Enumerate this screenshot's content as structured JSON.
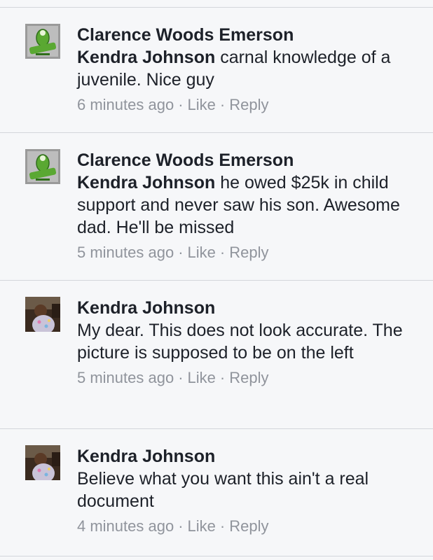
{
  "comments": [
    {
      "author": "Clarence Woods Emerson",
      "mention": "Kendra Johnson",
      "text": " carnal knowledge of a juvenile. Nice guy",
      "time": "6 minutes ago",
      "like": "Like",
      "reply": "Reply",
      "avatar": "turtle-logo-avatar"
    },
    {
      "author": "Clarence Woods Emerson",
      "mention": "Kendra Johnson",
      "text": " he owed $25k in child support and never saw his son. Awesome dad. He'll be missed",
      "time": "5 minutes ago",
      "like": "Like",
      "reply": "Reply",
      "avatar": "turtle-logo-avatar"
    },
    {
      "author": "Kendra Johnson",
      "mention": "",
      "text": "My dear. This does not look accurate. The picture is supposed to be on the left",
      "time": "5 minutes ago",
      "like": "Like",
      "reply": "Reply",
      "avatar": "child-photo-avatar"
    },
    {
      "author": "Kendra Johnson",
      "mention": "",
      "text": "Believe what you want this ain't a real document",
      "time": "4 minutes ago",
      "like": "Like",
      "reply": "Reply",
      "avatar": "child-photo-avatar"
    }
  ],
  "separator": "·",
  "colors": {
    "background": "#f6f7f9",
    "text": "#1d2129",
    "meta": "#90949c",
    "divider": "#d3d6db",
    "logo_green": "#5aa832"
  }
}
